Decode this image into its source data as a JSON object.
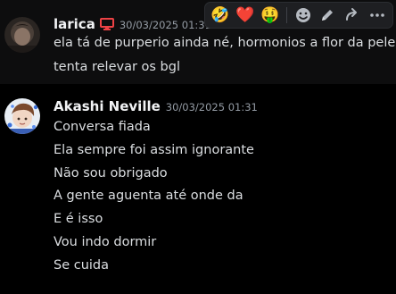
{
  "messages": [
    {
      "username": "larica",
      "timestamp": "30/03/2025 01:31",
      "lines": [
        "ela tá de purperio ainda né, hormonios a flor da pele",
        "tenta relevar os bgl"
      ],
      "role_icon": "monitor-icon",
      "role_icon_color": "#ed4245"
    },
    {
      "username": "Akashi Neville",
      "timestamp": "30/03/2025 01:31",
      "lines": [
        "Conversa fiada",
        "Ela sempre foi assim ignorante",
        "Não sou obrigado",
        "A gente aguenta até onde da",
        "E é isso",
        "Vou indo dormir",
        "Se cuida"
      ]
    }
  ],
  "toolbar": {
    "reactions": [
      {
        "emoji": "🤣",
        "icon": "rofl-emoji-icon"
      },
      {
        "emoji": "❤️",
        "icon": "heart-emoji-icon"
      },
      {
        "emoji": "🤑",
        "icon": "money-mouth-emoji-icon"
      }
    ],
    "actions": [
      {
        "icon": "add-reaction-icon"
      },
      {
        "icon": "edit-pencil-icon"
      },
      {
        "icon": "reply-arrow-icon"
      },
      {
        "icon": "more-options-icon"
      }
    ]
  },
  "colors": {
    "background": "#000000",
    "hover_background": "#0d0d0e",
    "username": "#f2f3f5",
    "timestamp": "#949ba4",
    "text": "#dbdee1",
    "toolbar_bg": "#1e1f22"
  }
}
